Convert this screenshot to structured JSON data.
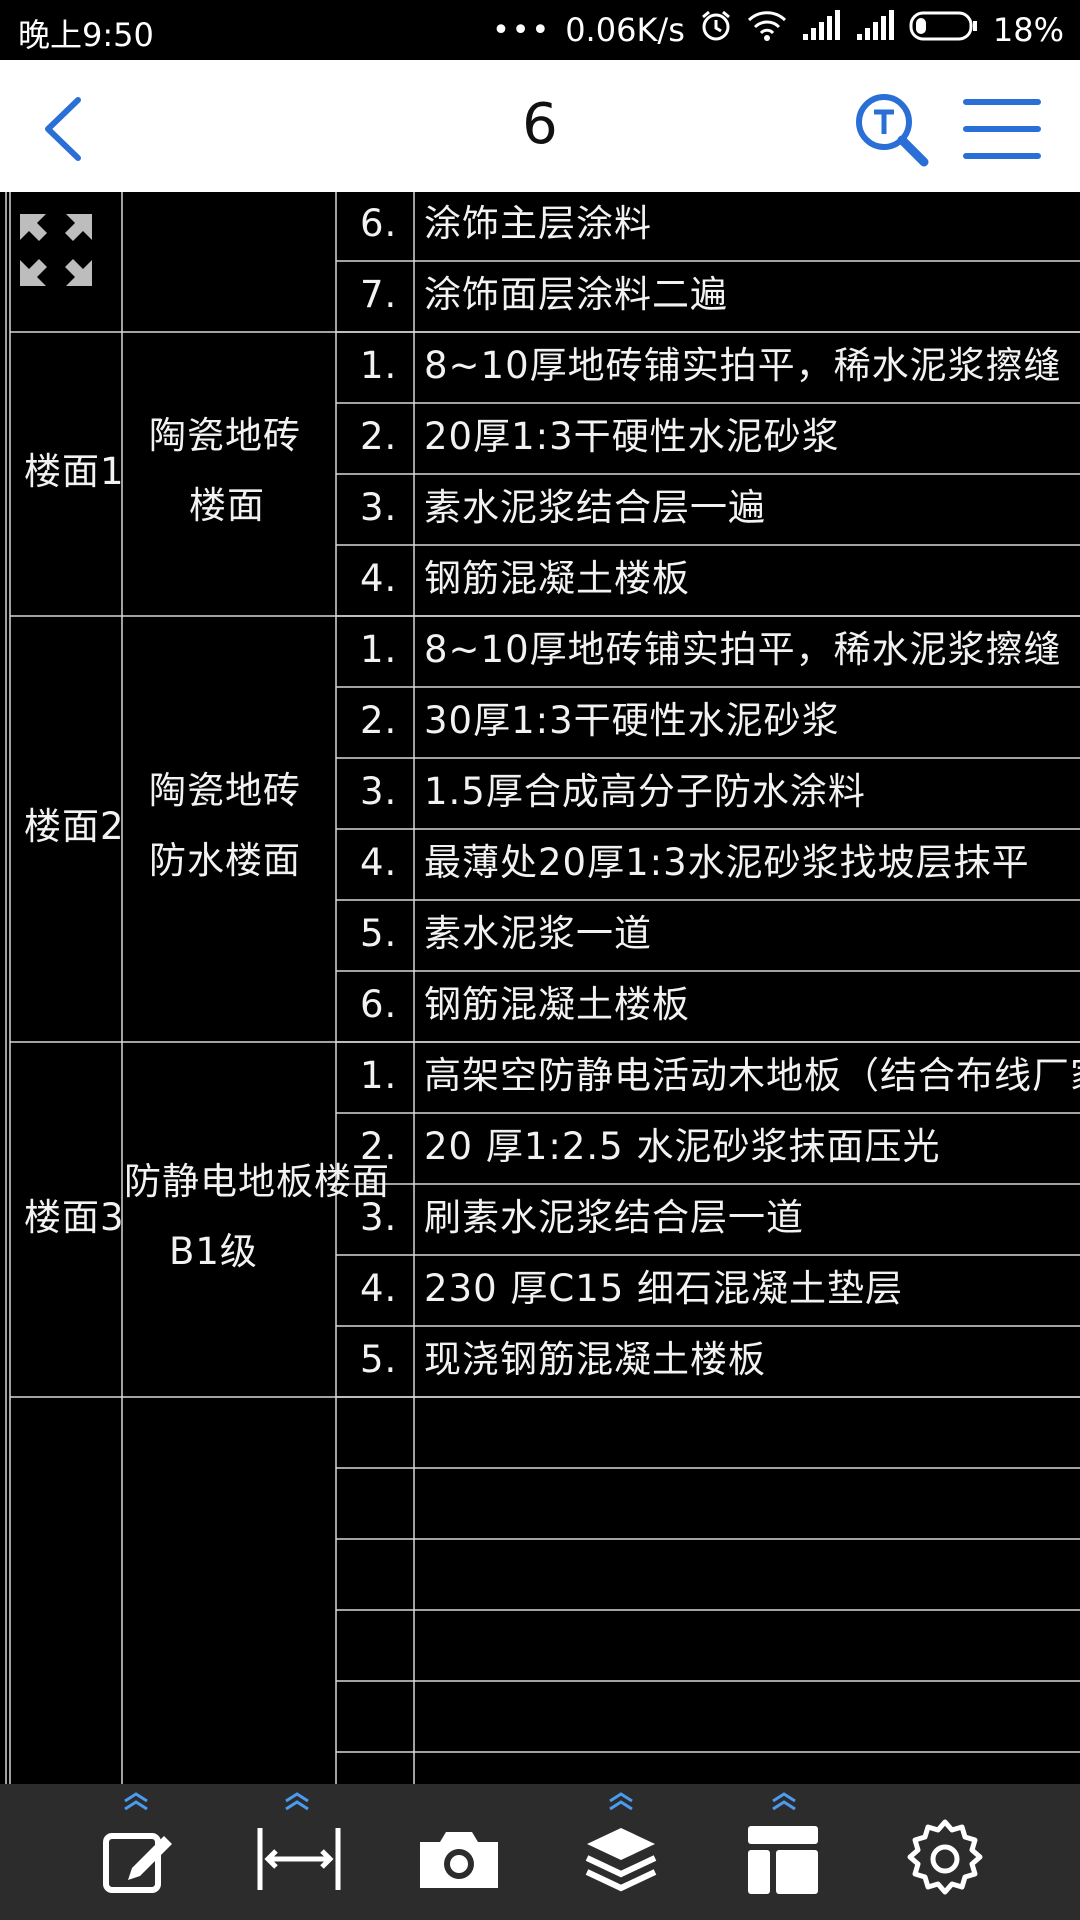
{
  "status_bar": {
    "time": "晚上9:50",
    "network_speed": "0.06K/s",
    "battery": "18%",
    "icons": [
      "more-dots-icon",
      "alarm-icon",
      "wifi-icon",
      "signal-icon",
      "signal-icon",
      "battery-icon"
    ]
  },
  "header": {
    "title": "6",
    "icons": [
      "back-icon",
      "text-search-icon",
      "menu-icon"
    ],
    "accent_color": "#2a6fd6"
  },
  "drawing": {
    "background": "#000000",
    "line_color": "#d8d8d8",
    "groups": [
      {
        "code": "",
        "name_lines": [],
        "steps": [
          {
            "num": "6.",
            "text": "涂饰主层涂料"
          },
          {
            "num": "7.",
            "text": "涂饰面层涂料二遍"
          }
        ]
      },
      {
        "code": "楼面1",
        "name_lines": [
          "陶瓷地砖",
          "楼面"
        ],
        "steps": [
          {
            "num": "1.",
            "text": "8~10厚地砖铺实拍平，稀水泥浆擦缝"
          },
          {
            "num": "2.",
            "text": "20厚1:3干硬性水泥砂浆"
          },
          {
            "num": "3.",
            "text": "素水泥浆结合层一遍"
          },
          {
            "num": "4.",
            "text": "钢筋混凝土楼板"
          }
        ]
      },
      {
        "code": "楼面2",
        "name_lines": [
          "陶瓷地砖",
          "防水楼面"
        ],
        "steps": [
          {
            "num": "1.",
            "text": "8~10厚地砖铺实拍平，稀水泥浆擦缝"
          },
          {
            "num": "2.",
            "text": "30厚1:3干硬性水泥砂浆"
          },
          {
            "num": "3.",
            "text": "1.5厚合成高分子防水涂料"
          },
          {
            "num": "4.",
            "text": "最薄处20厚1:3水泥砂浆找坡层抹平"
          },
          {
            "num": "5.",
            "text": "素水泥浆一道"
          },
          {
            "num": "6.",
            "text": "钢筋混凝土楼板"
          }
        ]
      },
      {
        "code": "楼面3",
        "name_lines": [
          "防静电地板楼面",
          "B1级"
        ],
        "steps": [
          {
            "num": "1.",
            "text": "高架空防静电活动木地板（结合布线厂家后方可施"
          },
          {
            "num": "2.",
            "text": "20  厚1:2.5    水泥砂浆抹面压光"
          },
          {
            "num": "3.",
            "text": "刷素水泥浆结合层一道"
          },
          {
            "num": "4.",
            "text": "230  厚C15  细石混凝土垫层"
          },
          {
            "num": "5.",
            "text": "现浇钢筋混凝土楼板"
          }
        ]
      }
    ],
    "fit_screen_icon": "fit-screen-icon"
  },
  "toolbar": {
    "background": "#2c2c2c",
    "icon_color": "#ffffff",
    "chevron_color": "#4a9cf0",
    "items": [
      {
        "icon": "edit-icon",
        "has_chevron": true
      },
      {
        "icon": "measure-icon",
        "has_chevron": true
      },
      {
        "icon": "camera-icon",
        "has_chevron": false
      },
      {
        "icon": "layers-icon",
        "has_chevron": true
      },
      {
        "icon": "layout-icon",
        "has_chevron": true
      },
      {
        "icon": "settings-icon",
        "has_chevron": false
      }
    ]
  }
}
